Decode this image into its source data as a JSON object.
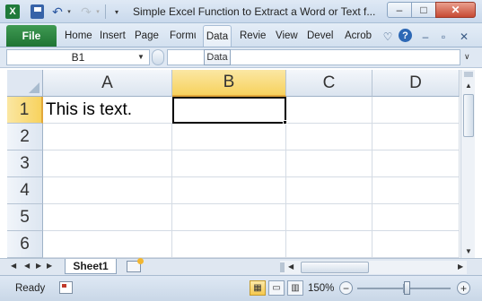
{
  "window": {
    "title": "Simple Excel Function to Extract a Word or Text f...",
    "app_icon_letter": "X",
    "minimize_glyph": "–",
    "maximize_glyph": "□",
    "close_glyph": "✕"
  },
  "quick_access": {
    "undo_glyph": "↶",
    "redo_glyph": "↷",
    "dropdown_glyph": "▾",
    "customize_glyph": "▾"
  },
  "ribbon": {
    "file_label": "File",
    "tabs": [
      "Home",
      "Insert",
      "Page",
      "Formu",
      "Data",
      "Revie",
      "View",
      "Devel",
      "Acrob"
    ],
    "active_tab": "Data",
    "heart_glyph": "♡",
    "help_glyph": "?",
    "min_glyph": "–",
    "max_glyph": "▫",
    "close_glyph": "✕"
  },
  "formula_bar": {
    "name_box": "B1",
    "name_drop": "▼",
    "formula": "",
    "expand_glyph": "∨",
    "tooltip": "Data"
  },
  "sheet": {
    "columns": [
      "A",
      "B",
      "C",
      "D"
    ],
    "rows": [
      "1",
      "2",
      "3",
      "4",
      "5",
      "6"
    ],
    "selected_cell": "B1",
    "cells": {
      "A1": "This is text."
    }
  },
  "sheet_tabs": {
    "nav": [
      "◀",
      "◀",
      "▶",
      "▶"
    ],
    "tabs": [
      "Sheet1"
    ],
    "scroll_left": "◀",
    "scroll_right": "▶"
  },
  "scrollbar": {
    "up": "▲",
    "down": "▼"
  },
  "status": {
    "mode": "Ready",
    "zoom": "150%",
    "zoom_out": "−",
    "zoom_in": "+"
  },
  "colors": {
    "file_tab": "#1f7434",
    "selected_header": "#f7d25e",
    "close_button": "#c74a33"
  },
  "icons": {
    "app": "excel-icon",
    "save": "save-icon",
    "undo": "undo-icon",
    "redo": "redo-icon",
    "help": "help-icon",
    "new_sheet": "insert-worksheet-icon",
    "macro": "macro-record-icon"
  }
}
